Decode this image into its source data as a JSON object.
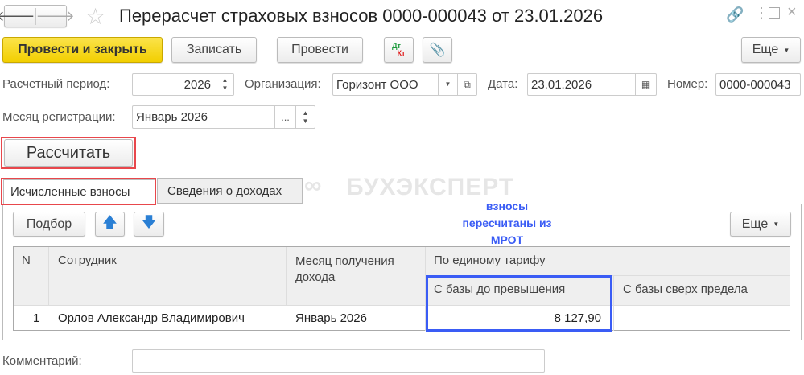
{
  "header": {
    "title": "Перерасчет страховых взносов 0000-000043 от 23.01.2026"
  },
  "toolbar": {
    "post_close": "Провести и закрыть",
    "save": "Записать",
    "post": "Провести",
    "dt": "Дт",
    "kt": "Кт",
    "more": "Еще"
  },
  "fields": {
    "period_label": "Расчетный период:",
    "period_value": "2026",
    "org_label": "Организация:",
    "org_value": "Горизонт ООО",
    "date_label": "Дата:",
    "date_value": "23.01.2026",
    "number_label": "Номер:",
    "number_value": "0000-000043",
    "reg_month_label": "Месяц регистрации:",
    "reg_month_value": "Январь 2026",
    "ellipsis": "..."
  },
  "calc_button": "Рассчитать",
  "tabs": [
    {
      "label": "Исчисленные взносы"
    },
    {
      "label": "Сведения о доходах"
    }
  ],
  "watermark": "БУХЭКСПЕРТ",
  "annotation": "взносы пересчитаны из МРОТ",
  "table_toolbar": {
    "pick": "Подбор",
    "more": "Еще"
  },
  "table": {
    "headers": {
      "n": "N",
      "employee": "Сотрудник",
      "month": "Месяц получения дохода",
      "tariff": "По единому тарифу",
      "below": "С базы до превышения",
      "above": "С базы сверх предела"
    },
    "rows": [
      {
        "n": "1",
        "employee": "Орлов Александр Владимирович",
        "month": "Январь 2026",
        "below": "8 127,90",
        "above": ""
      }
    ]
  },
  "comment": {
    "label": "Комментарий:",
    "value": ""
  },
  "colors": {
    "accent_red": "#e8474c",
    "accent_blue": "#3050f0",
    "primary_yellow": "#f5d800"
  }
}
